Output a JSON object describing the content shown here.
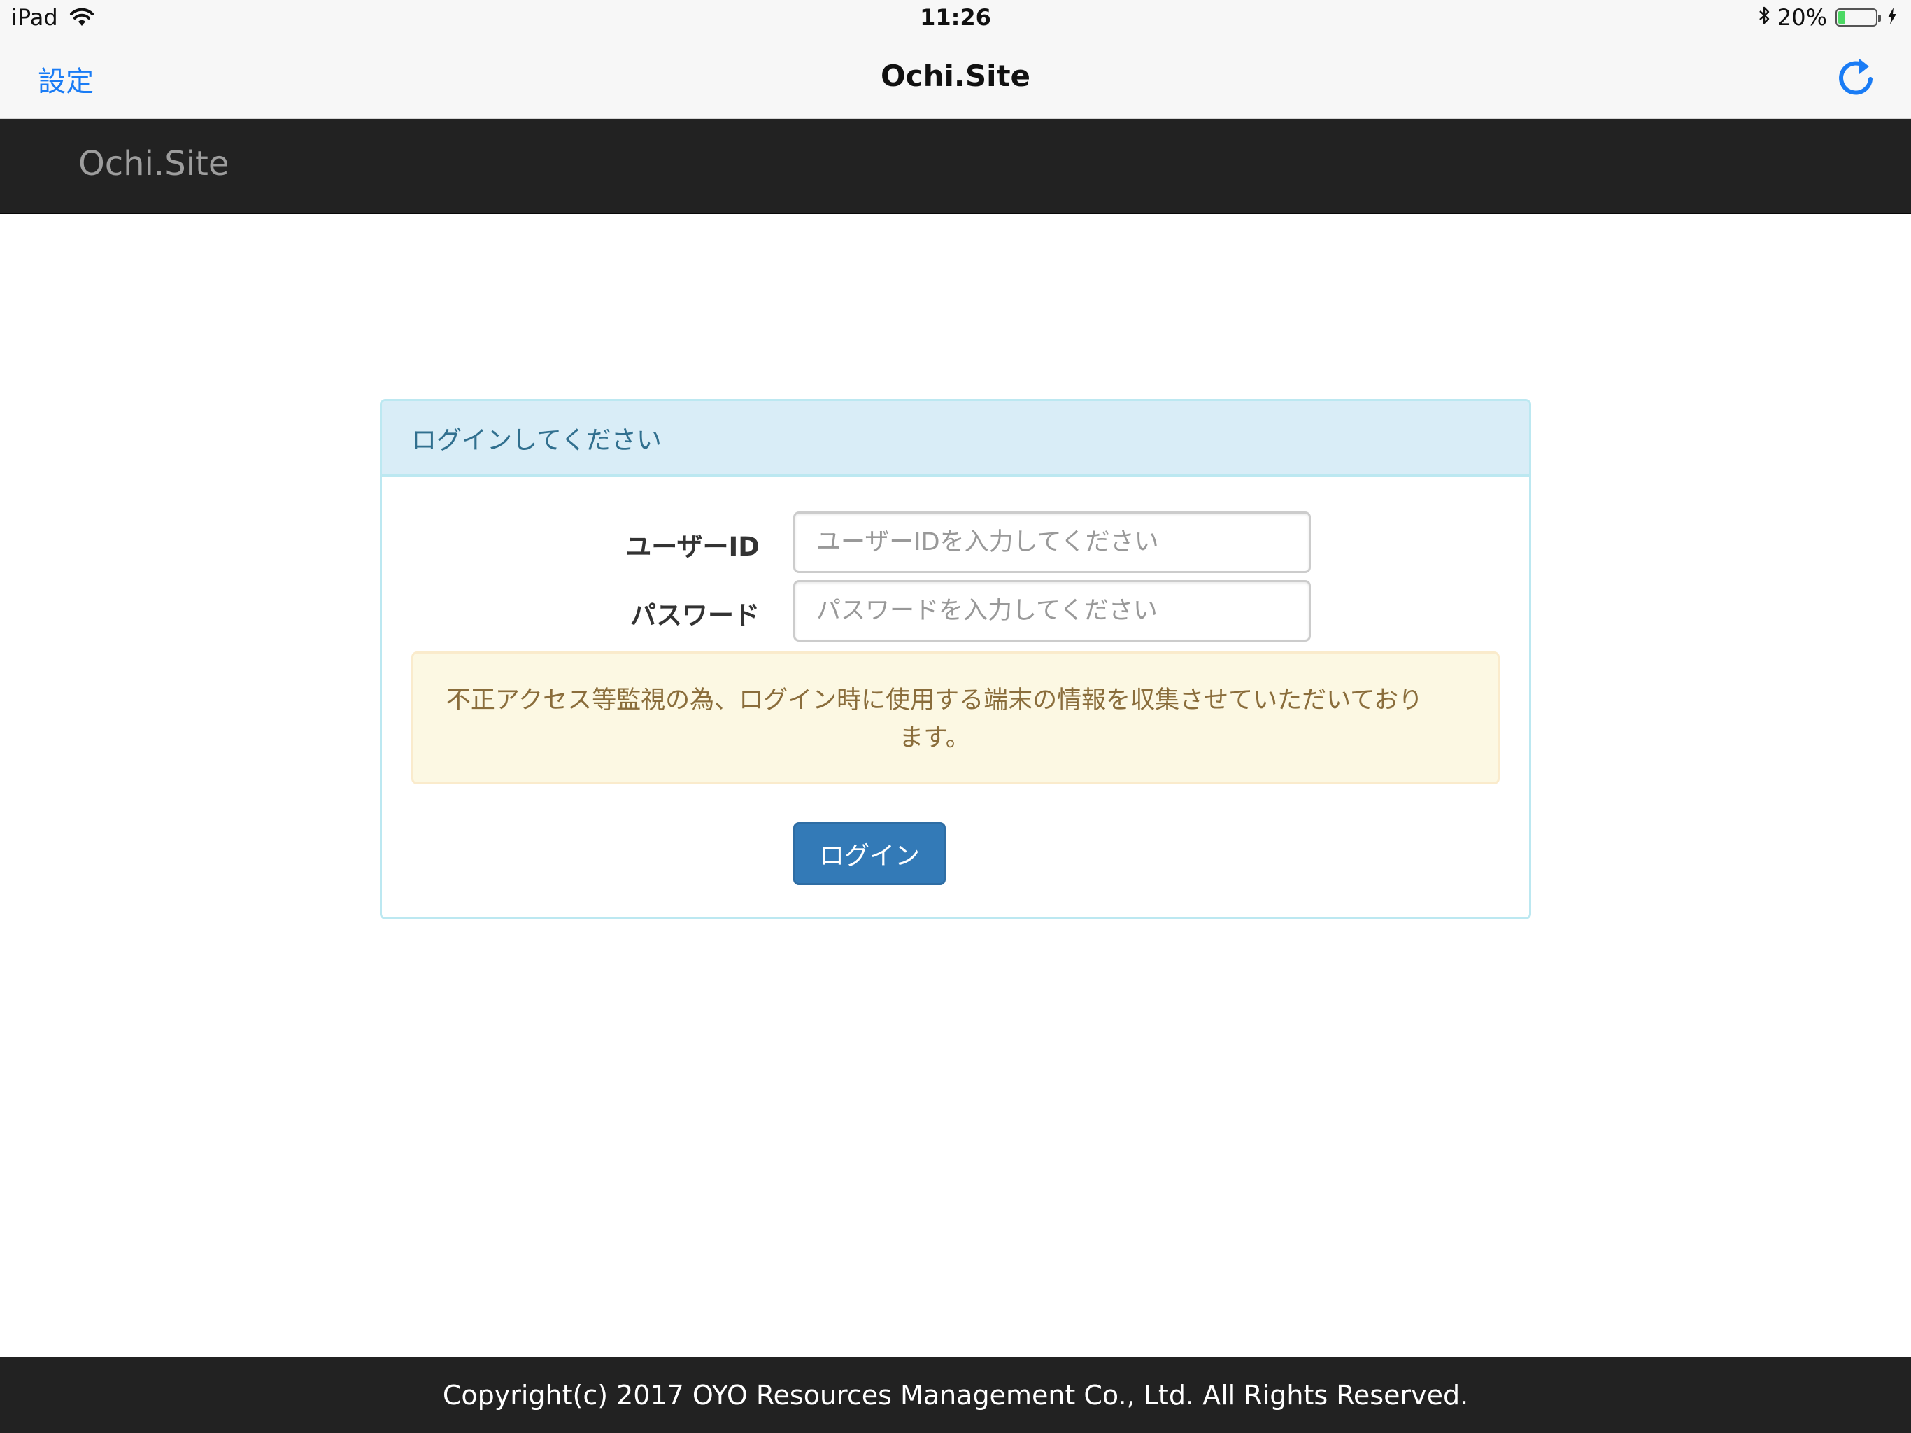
{
  "status_bar": {
    "device": "iPad",
    "time": "11:26",
    "battery_percent": "20%",
    "battery_level": 0.2,
    "wifi_icon": "wifi-icon",
    "bluetooth_icon": "bluetooth-icon",
    "charging_icon": "bolt-icon"
  },
  "nav": {
    "back_label": "設定",
    "title": "Ochi.Site",
    "refresh_icon": "refresh-icon",
    "accent_color": "#1a7cf5"
  },
  "header": {
    "brand": "Ochi.Site"
  },
  "login": {
    "panel_title": "ログインしてください",
    "user_id_label": "ユーザーID",
    "user_id_value": "",
    "user_id_placeholder": "ユーザーIDを入力してください",
    "password_label": "パスワード",
    "password_value": "",
    "password_placeholder": "パスワードを入力してください",
    "notice": "不正アクセス等監視の為、ログイン時に使用する端末の情報を収集させていただいております。",
    "submit_label": "ログイン",
    "button_color": "#337ab7"
  },
  "footer": {
    "copyright": "Copyright(c) 2017 OYO Resources Management Co., Ltd. All Rights Reserved."
  }
}
